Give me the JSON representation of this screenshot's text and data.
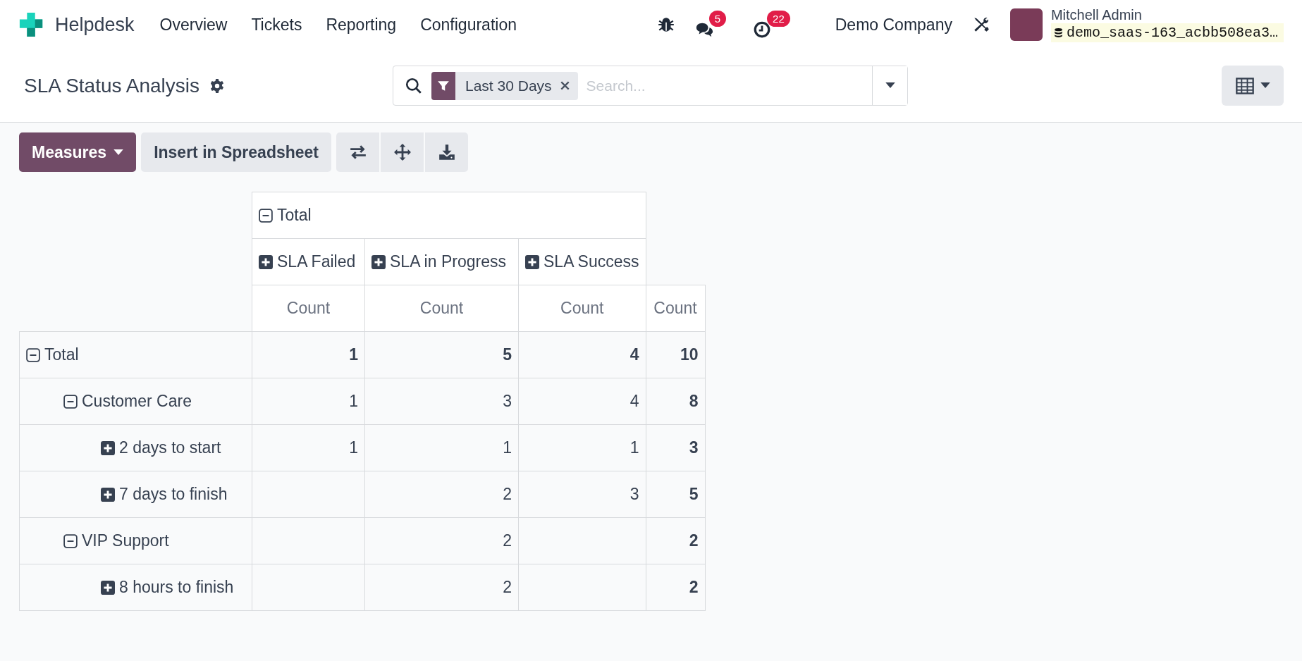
{
  "app": {
    "name": "Helpdesk"
  },
  "menu": [
    {
      "label": "Overview"
    },
    {
      "label": "Tickets"
    },
    {
      "label": "Reporting"
    },
    {
      "label": "Configuration"
    }
  ],
  "systray": {
    "messages_badge": "5",
    "activities_badge": "22",
    "company": "Demo Company",
    "user": {
      "name": "Mitchell Admin",
      "database": "demo_saas-163_acbb508ea3…"
    }
  },
  "control_panel": {
    "title": "SLA Status Analysis",
    "search": {
      "facets": [
        {
          "label": "Last 30 Days"
        }
      ],
      "placeholder": "Search..."
    }
  },
  "toolbar": {
    "measures": "Measures",
    "insert": "Insert in Spreadsheet"
  },
  "pivot": {
    "col_header": {
      "label": "Total",
      "expanded": true,
      "children": [
        {
          "label": "SLA Failed",
          "expanded": false
        },
        {
          "label": "SLA in Progress",
          "expanded": false
        },
        {
          "label": "SLA Success",
          "expanded": false
        }
      ]
    },
    "measure_labels": [
      "Count",
      "Count",
      "Count",
      "Count"
    ],
    "rows": [
      {
        "label": "Total",
        "expanded": true,
        "values": {
          "sla_failed": "1",
          "sla_in_progress": "5",
          "sla_success": "4",
          "total": "10"
        },
        "children": [
          {
            "label": "Customer Care",
            "expanded": true,
            "values": {
              "sla_failed": "1",
              "sla_in_progress": "3",
              "sla_success": "4",
              "total": "8"
            },
            "children": [
              {
                "label": "2 days to start",
                "expanded": false,
                "values": {
                  "sla_failed": "1",
                  "sla_in_progress": "1",
                  "sla_success": "1",
                  "total": "3"
                }
              },
              {
                "label": "7 days to finish",
                "expanded": false,
                "values": {
                  "sla_in_progress": "2",
                  "sla_success": "3",
                  "total": "5"
                }
              }
            ]
          },
          {
            "label": "VIP Support",
            "expanded": true,
            "values": {
              "sla_in_progress": "2",
              "total": "2"
            },
            "children": [
              {
                "label": "8 hours to finish",
                "expanded": false,
                "values": {
                  "sla_in_progress": "2",
                  "total": "2"
                }
              }
            ]
          }
        ]
      }
    ]
  }
}
